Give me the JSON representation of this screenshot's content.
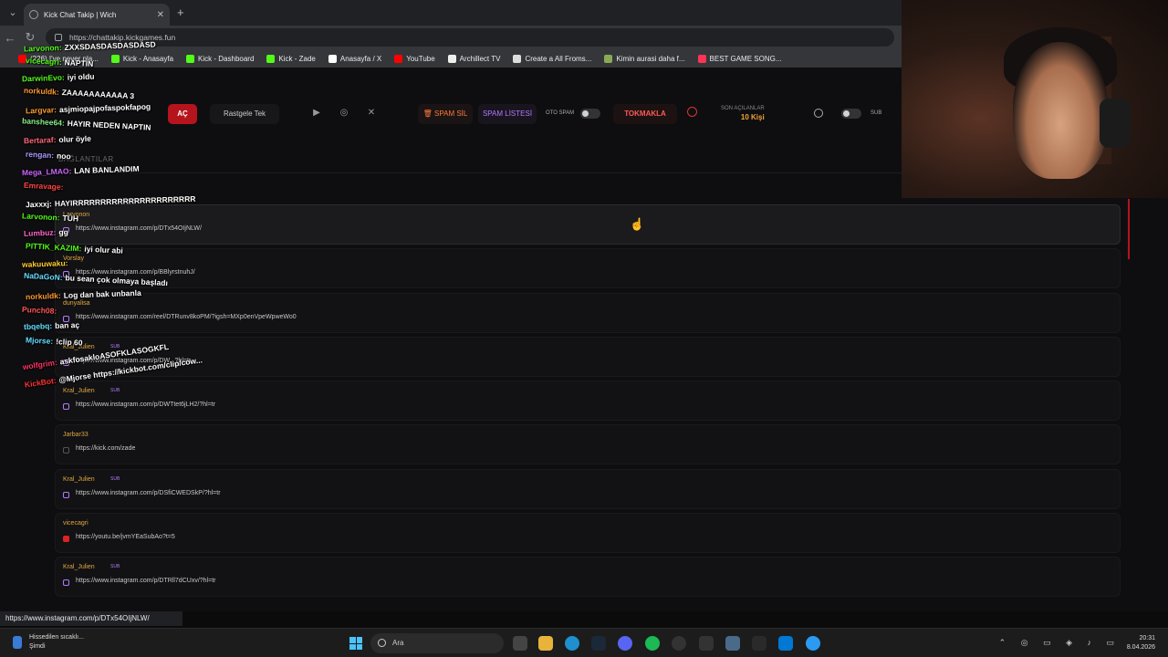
{
  "browser": {
    "tab_title": "Kick Chat Takip | Wich",
    "url": "https://chattakip.kickgames.fun",
    "bookmarks": [
      {
        "label": "(226) I've never pla...",
        "color": "#ff0000"
      },
      {
        "label": "Kick - Anasayfa",
        "color": "#53fc18"
      },
      {
        "label": "Kick - Dashboard",
        "color": "#53fc18"
      },
      {
        "label": "Kick - Zade",
        "color": "#53fc18"
      },
      {
        "label": "Anasayfa / X",
        "color": "#ffffff"
      },
      {
        "label": "YouTube",
        "color": "#ff0000"
      },
      {
        "label": "Archillect TV",
        "color": "#eeeeee"
      },
      {
        "label": "Create a All Froms...",
        "color": "#dddddd"
      },
      {
        "label": "Kimin aurasi daha f...",
        "color": "#88aa55"
      },
      {
        "label": "BEST GAME SONG...",
        "color": "#ff3355"
      }
    ]
  },
  "toolbar": {
    "ac_label": "AÇ",
    "rastgele_label": "Rastgele Tek",
    "spam_sil_label": "SPAM SİL",
    "spam_listesi_label": "SPAM LİSTESİ",
    "oto_spam_label": "OTO SPAM",
    "tokmakla_label": "TOKMAKLA",
    "son_acilanlar_label": "SON AÇILANLAR",
    "son_acilanlar_value": "10 Kişi",
    "sub_label": "SUB"
  },
  "section_label": "BAĞLANTILAR",
  "feed": [
    {
      "user": "Larvonon",
      "sub": false,
      "link": "https://www.instagram.com/p/DTx54OIjNLW/",
      "icon": "instagram-icon"
    },
    {
      "user": "Vorslay",
      "sub": false,
      "link": "https://www.instagram.com/p/BBlyrstnuhJ/",
      "icon": "instagram-icon"
    },
    {
      "user": "dunyalisa",
      "sub": false,
      "link": "https://www.instagram.com/reel/DTRunv8koPM/?igsh=MXp0enVpeWpweWo0",
      "icon": "instagram-icon"
    },
    {
      "user": "Kral_Julien",
      "sub": true,
      "link": "https://www.instagram.com/p/DW...?hl=tr",
      "icon": "instagram-icon"
    },
    {
      "user": "Kral_Julien",
      "sub": true,
      "link": "https://www.instagram.com/p/DWTtet6jLH2/?hl=tr",
      "icon": "instagram-icon"
    },
    {
      "user": "Jarbar33",
      "sub": false,
      "link": "https://kick.com/zade",
      "icon": "link-icon"
    },
    {
      "user": "Kral_Julien",
      "sub": true,
      "link": "https://www.instagram.com/p/DSfiCWEDSkP/?hl=tr",
      "icon": "instagram-icon"
    },
    {
      "user": "vicecagri",
      "sub": false,
      "link": "https://youtu.be/jvmYEaSubAo?t=5",
      "icon": "youtube-icon"
    },
    {
      "user": "Kral_Julien",
      "sub": true,
      "link": "https://www.instagram.com/p/DTRll7dCUxv/?hl=tr",
      "icon": "instagram-icon"
    }
  ],
  "chat": [
    {
      "name": "Larvonon:",
      "color": "#53fc18",
      "msg": "ZXXSDASDASDASDASD"
    },
    {
      "name": "vicecagri:",
      "color": "#53fc18",
      "msg": "NAPTIN"
    },
    {
      "name": "DarwinEvo:",
      "color": "#53fc18",
      "msg": "iyi oldu"
    },
    {
      "name": "norkuldk:",
      "color": "#ff9933",
      "msg": "ZAAAAAAAAAAA 3"
    },
    {
      "name": "Largvar:",
      "color": "#ff9933",
      "msg": "asjmiopajpofaspokfapog"
    },
    {
      "name": "banshee64:",
      "color": "#88ee88",
      "msg": "HAYIR NEDEN NAPTIN"
    },
    {
      "name": "Bertaraf:",
      "color": "#ff6677",
      "msg": "olur öyle"
    },
    {
      "name": "rengan:",
      "color": "#aa99ff",
      "msg": "noo"
    },
    {
      "name": "Mega_LMAO:",
      "color": "#cc66ff",
      "msg": "LAN BANLANDIM"
    },
    {
      "name": "Emravage:",
      "color": "#ff4444",
      "msg": ""
    },
    {
      "name": "Jaxxxj:",
      "color": "#ffffff",
      "msg": "HAYIRRRRRRRRRRRRRRRRRRRRRR"
    },
    {
      "name": "Larvonon:",
      "color": "#53fc18",
      "msg": "TÜH"
    },
    {
      "name": "Lumbuz:",
      "color": "#ff66cc",
      "msg": "gg"
    },
    {
      "name": "PITTIK_KAZIM:",
      "color": "#53fc18",
      "msg": "iyi olur abi"
    },
    {
      "name": "wakuuwaku:",
      "color": "#ffcc33",
      "msg": ""
    },
    {
      "name": "NaDaGoN:",
      "color": "#66ddff",
      "msg": "bu sean çok olmaya başladı"
    },
    {
      "name": "norkuldk:",
      "color": "#ff9933",
      "msg": "Log dan bak unbanla"
    },
    {
      "name": "Punch08:",
      "color": "#ff5555",
      "msg": ""
    },
    {
      "name": "tbqebq:",
      "color": "#66ddff",
      "msg": "ban aç"
    },
    {
      "name": "Mjorse:",
      "color": "#66ddff",
      "msg": "!clip 60"
    },
    {
      "name": "wolfgrim:",
      "color": "#ff3366",
      "msg": "askfosakloASOFKLASOGKFL"
    },
    {
      "name": "KickBot:",
      "color": "#ff3333",
      "msg": "@Mjorse https://kickbot.com/clip/cow..."
    }
  ],
  "status_url": "https://www.instagram.com/p/DTx54OIjNLW/",
  "taskbar": {
    "weather_line1": "Hissedilen sıcaklı...",
    "weather_line2": "Şimdi",
    "search_label": "Ara",
    "time": "20:31",
    "date": "8.04.2026"
  },
  "colors": {
    "accent": "#b5141d",
    "kick_green": "#53fc18",
    "sub_purple": "#b07aff",
    "user_gold": "#e0a640"
  }
}
